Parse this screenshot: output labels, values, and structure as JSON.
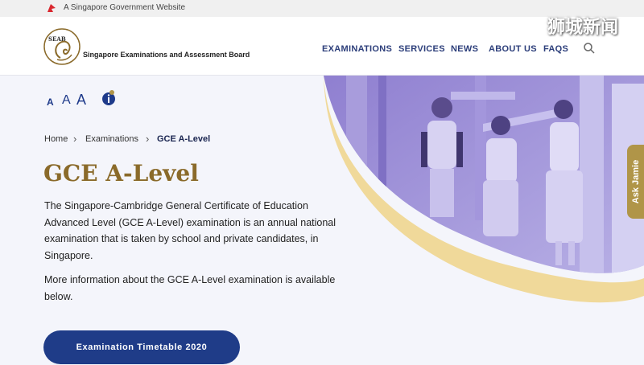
{
  "gov_bar": {
    "text": "A Singapore Government Website",
    "icon": "lion-head-icon"
  },
  "brand": {
    "logo_text": "SEAB",
    "name": "Singapore Examinations and Assessment Board"
  },
  "nav": {
    "items": [
      {
        "label": "EXAMINATIONS"
      },
      {
        "label": "SERVICES"
      },
      {
        "label": "NEWS"
      },
      {
        "label": "ABOUT US"
      },
      {
        "label": "FAQS"
      }
    ],
    "search_icon": "search-icon"
  },
  "watermark": "狮城新闻",
  "font_size_controls": {
    "small": "A",
    "medium": "A",
    "large": "A",
    "info_icon": "info-icon"
  },
  "breadcrumb": {
    "home": "Home",
    "section": "Examinations",
    "current": "GCE A-Level"
  },
  "page": {
    "title": "GCE A-Level",
    "intro_1": "The Singapore-Cambridge General Certificate of Education Advanced Level (GCE A-Level) examination is an annual national examination that is taken by school and private candidates, in Singapore.",
    "intro_2": "More information about the GCE A-Level examination is available below."
  },
  "cta_button": "Examination Timetable 2020",
  "ask_tab": "Ask Jamie",
  "colors": {
    "primary": "#1f3c88",
    "title_gold": "#8a6a2a",
    "accent_gold": "#f0d99a",
    "hero_purple": "#9a8fd6"
  }
}
